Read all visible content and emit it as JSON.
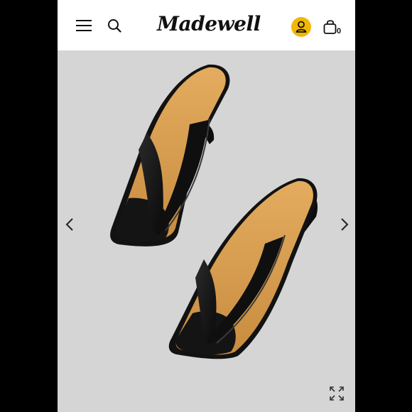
{
  "header": {
    "logo_text": "Madewell",
    "bag_count": "0",
    "icons": {
      "menu": "hamburger-menu-icon",
      "search": "search-icon",
      "account": "account-icon",
      "bag": "shopping-bag-icon"
    },
    "accent_color": "#f2b705"
  },
  "gallery": {
    "image": "black-leather-thong-kitten-heel-sandals",
    "prev_icon": "chevron-left-icon",
    "next_icon": "chevron-right-icon",
    "expand_icon": "expand-icon",
    "background_color": "#d5d5d5"
  }
}
